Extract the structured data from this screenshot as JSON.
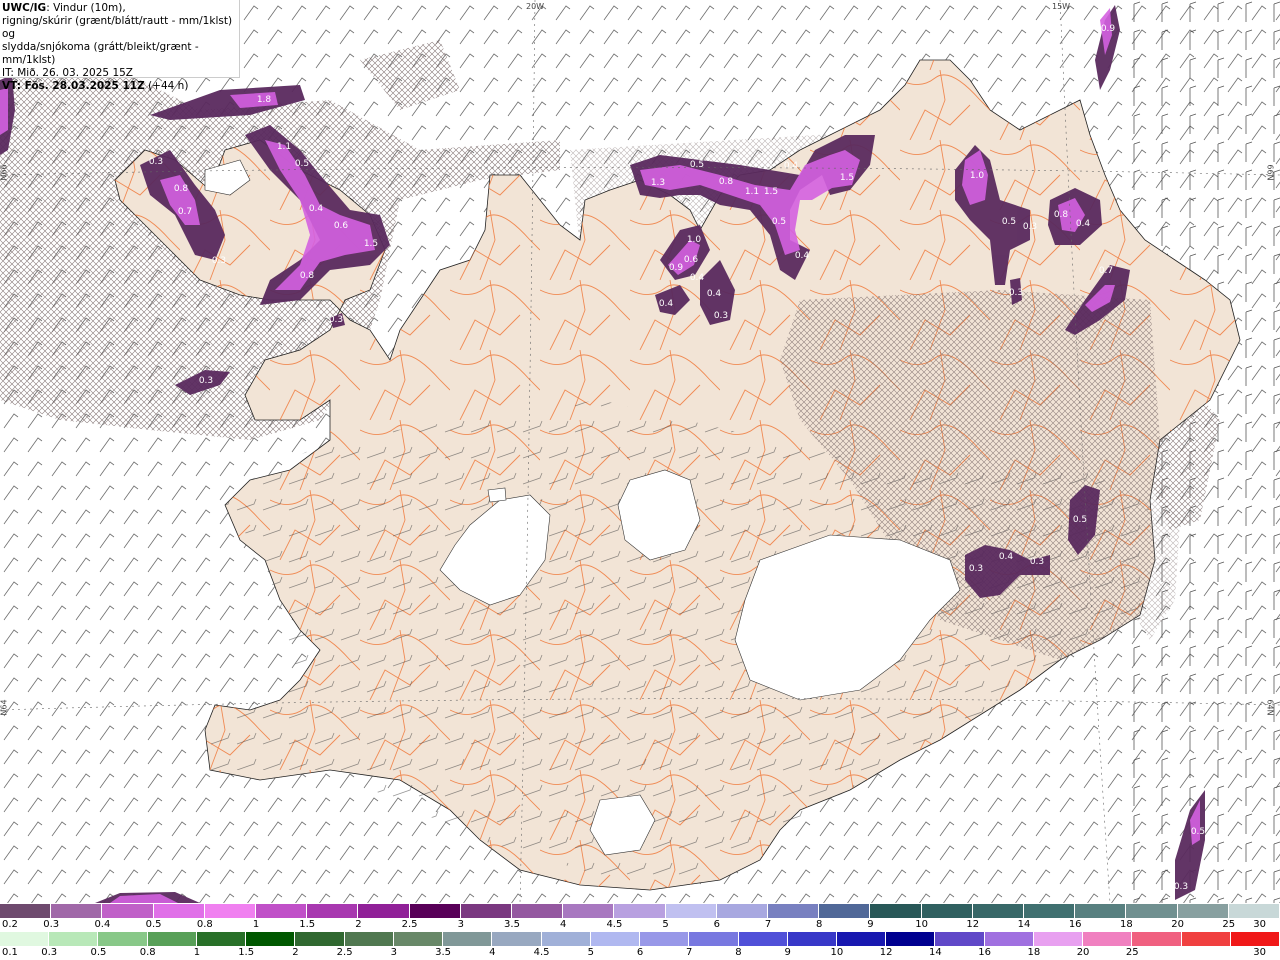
{
  "info": {
    "line1_bold": "UWC/IG",
    "line1_rest": ": Vindur (10m),",
    "line2": "rigning/skúrir (grænt/blátt/rautt - mm/1klst) og",
    "line3": "slydda/snjókoma (grátt/bleikt/grænt - mm/1klst)",
    "line4": "IT: Mið. 26. 03. 2025 15Z",
    "line5_bold": "VT: Fös. 28.03.2025 11Z",
    "line5_rest": " (+44 h)"
  },
  "grid_labels": {
    "top_20w": "20W",
    "top_15w": "15W",
    "left_66n": "N66",
    "right_66n": "66N",
    "left_64n": "N64",
    "right_64n": "64N"
  },
  "colors": {
    "land": "#f2e4d6",
    "roads": "#f07a3c",
    "glacier": "#ffffff",
    "snow_precip": "#a040b0",
    "snow_precip_dark": "#5a2a5e"
  },
  "precip_labels": [
    "1.8",
    "1.1",
    "0.5",
    "0.4",
    "0.6",
    "1.5",
    "0.8",
    "0.3",
    "0.8",
    "0.7",
    "0.3",
    "0.3",
    "0.3",
    "0.5",
    "0.4",
    "1.3",
    "0.8",
    "1.1",
    "1.5",
    "1.5",
    "0.4",
    "0.5",
    "1.0",
    "0.6",
    "0.9",
    "0.4",
    "0.4",
    "0.4",
    "0.3",
    "1.0",
    "0.5",
    "0.3",
    "0.8",
    "0.4",
    "0.7",
    "0.3",
    "0.9",
    "0.5",
    "0.4",
    "0.3",
    "0.3",
    "0.5",
    "0.3"
  ],
  "colorbar_snow": {
    "labels": [
      "0.2",
      "0.3",
      "0.4",
      "0.5",
      "0.8",
      "1",
      "1.5",
      "2",
      "2.5",
      "3",
      "3.5",
      "4",
      "4.5",
      "5",
      "6",
      "7",
      "8",
      "9",
      "10",
      "12",
      "14",
      "16",
      "18",
      "20",
      "25",
      "30"
    ],
    "colors": [
      "#6e4a6e",
      "#a068a8",
      "#c060c8",
      "#e070e8",
      "#f080f0",
      "#c050c8",
      "#a838b0",
      "#902098",
      "#580058",
      "#7a3880",
      "#9458a0",
      "#a878c0",
      "#b8a0e0",
      "#c0c0f0",
      "#a8a8e0",
      "#7880c0",
      "#506898",
      "#285858",
      "#306060",
      "#386868",
      "#407070",
      "#588080",
      "#709090",
      "#88a0a0",
      "#c8d8d8"
    ]
  },
  "colorbar_rain": {
    "labels": [
      "0.1",
      "0.3",
      "0.5",
      "0.8",
      "1",
      "1.5",
      "2",
      "2.5",
      "3",
      "3.5",
      "4",
      "4.5",
      "5",
      "6",
      "7",
      "8",
      "9",
      "10",
      "12",
      "14",
      "16",
      "18",
      "20",
      "25",
      "30"
    ],
    "colors": [
      "#e0f8e0",
      "#b8e8b8",
      "#88c888",
      "#58a058",
      "#287028",
      "#005800",
      "#306830",
      "#507850",
      "#688868",
      "#809898",
      "#98a8c0",
      "#a0b0d8",
      "#b0b8f0",
      "#9898e8",
      "#7878e0",
      "#5050d8",
      "#3838c8",
      "#1818b0",
      "#000090",
      "#6048c8",
      "#a070e0",
      "#e8a0f0",
      "#f080c0",
      "#f06080",
      "#f04040",
      "#f01818"
    ]
  }
}
